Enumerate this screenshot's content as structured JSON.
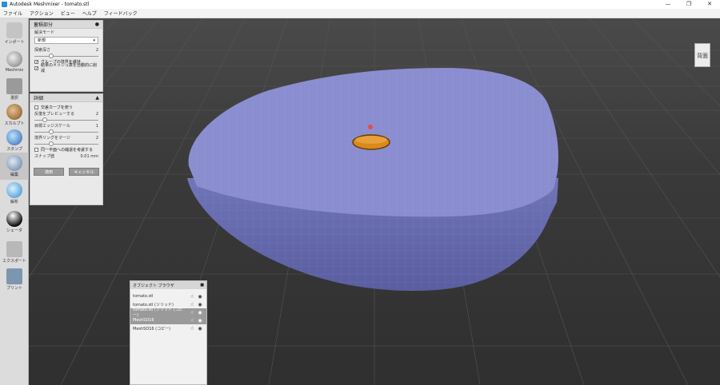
{
  "window": {
    "title": "Autodesk Meshmixer - tomato.stl",
    "controls": [
      "—",
      "❐",
      "✕"
    ]
  },
  "menu": [
    "ファイル",
    "アクション",
    "ビュー",
    "ヘルプ",
    "フィードバック"
  ],
  "toolbar": [
    {
      "label": "インポート",
      "icon": "plus-icon",
      "color": "#9c9c9c"
    },
    {
      "label": "Meshmix",
      "icon": "meshmix-icon",
      "color": "#8a8a8a"
    },
    {
      "label": "選択",
      "icon": "select-icon",
      "color": "#7a7a7a"
    },
    {
      "label": "スカルプト",
      "icon": "sculpt-icon",
      "color": "#a07040"
    },
    {
      "label": "スタンプ",
      "icon": "stamp-icon",
      "color": "#4a86c8"
    },
    {
      "label": "編集",
      "icon": "edit-icon",
      "color": "#6f8faf"
    },
    {
      "label": "解析",
      "icon": "analysis-icon",
      "color": "#4aa0d8"
    },
    {
      "label": "シェーダ",
      "icon": "shader-icon",
      "color": "#333333"
    },
    {
      "label": "エクスポート",
      "icon": "export-icon",
      "color": "#888888"
    },
    {
      "label": "プリント",
      "icon": "print-icon",
      "color": "#5a7a9a"
    }
  ],
  "panel_main": {
    "title": "蓄積部分",
    "mode_label": "解決モード",
    "mode_value": "新規",
    "depth_label": "探索深さ",
    "depth_value": "2",
    "checks": [
      {
        "label": "グループの境界を維持",
        "checked": true
      },
      {
        "label": "結果のメッシュ数を自動的に削減",
        "checked": true
      }
    ]
  },
  "panel_detail": {
    "title": "詳細",
    "check_curve": {
      "label": "交差カーブを使う",
      "checked": false
    },
    "preview_label": "反復をプレビューする",
    "preview_value": "2",
    "edge_label": "目標エッジスケール",
    "edge_value": "1",
    "merge_label": "境界リングをマージ",
    "merge_value": "2",
    "check_plane": {
      "label": "同一平面への縮退を考慮する",
      "checked": false
    },
    "snap_label": "スナップ値",
    "snap_value": "0.01",
    "snap_unit": "mm",
    "apply_label": "適用",
    "cancel_label": "キャンセル"
  },
  "browser": {
    "title": "オブジェクト ブラウザ",
    "items": [
      {
        "name": "tomato.stl",
        "selected": false
      },
      {
        "name": "tomato.stl (ソリッド)",
        "selected": false
      },
      {
        "name": "tomato.stl (ソリッド (コピー)",
        "selected": true
      },
      {
        "name": "MeshSD16",
        "selected": true
      },
      {
        "name": "MeshSD16 (コピー)",
        "selected": false
      }
    ]
  },
  "navcube": {
    "label": "背面"
  },
  "colors": {
    "mesh": "#8a8ed0",
    "hole": "#d98a1a",
    "grid": "#555555"
  }
}
